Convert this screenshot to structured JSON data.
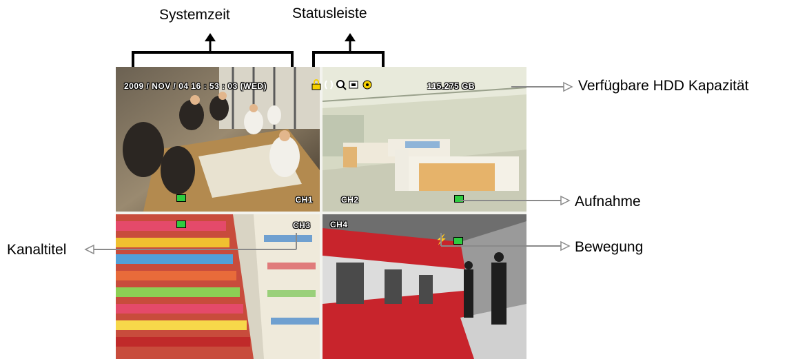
{
  "annotations": {
    "systemzeit": "Systemzeit",
    "statusleiste": "Statusleiste",
    "hdd": "Verfügbare HDD Kapazität",
    "aufnahme": "Aufnahme",
    "kanaltitel": "Kanaltitel",
    "bewegung": "Bewegung"
  },
  "osd": {
    "datetime": "2009 / NOV / 04  16 : 53 : 03 (WED)",
    "hdd_capacity": "115.275 GB"
  },
  "channels": [
    {
      "title": "CH1",
      "scene": "meeting room"
    },
    {
      "title": "CH2",
      "scene": "hospital ward"
    },
    {
      "title": "CH3",
      "scene": "supermarket aisle"
    },
    {
      "title": "CH4",
      "scene": "subway platform"
    }
  ],
  "status_icons": [
    "lock-icon",
    "network-icon",
    "zoom-icon",
    "usb-icon",
    "disk-icon"
  ],
  "colors": {
    "osd_text": "#ffffff",
    "record_icon": "#2ecc40",
    "motion_icon": "#f2c200",
    "lock_icon": "#f5d000"
  }
}
